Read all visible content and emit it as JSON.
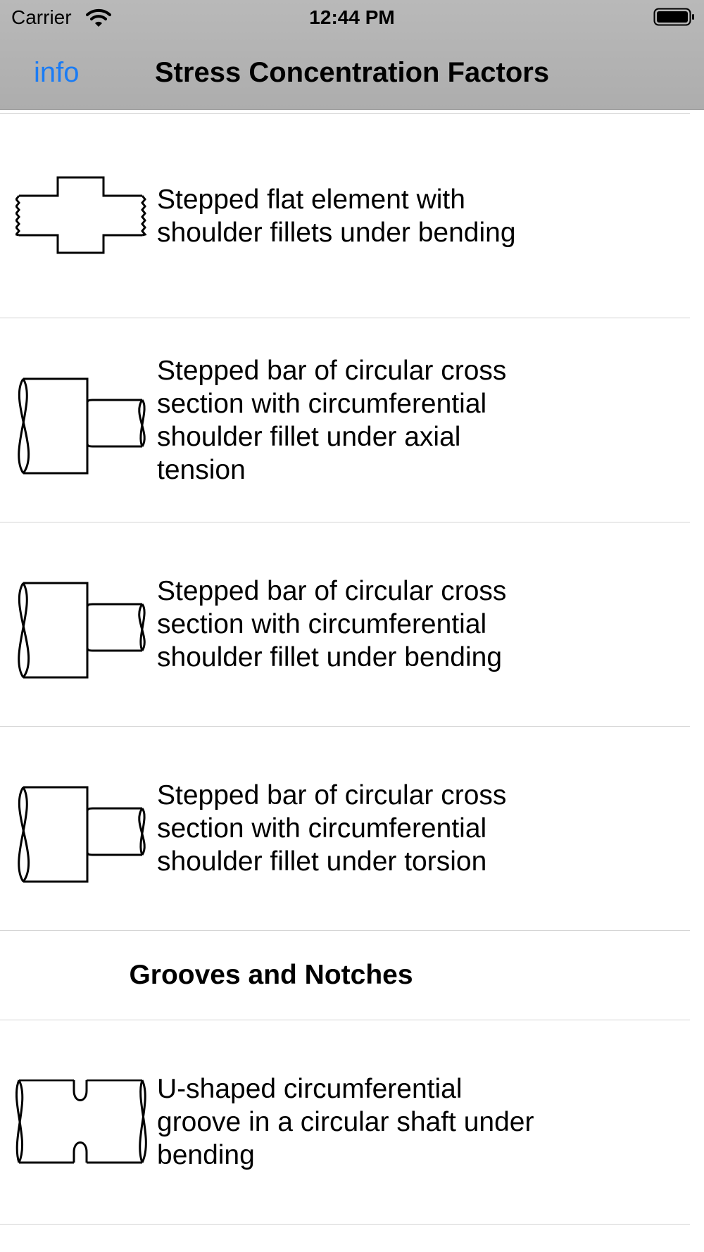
{
  "status_bar": {
    "carrier": "Carrier",
    "time": "12:44 PM",
    "wifi_icon": "wifi-icon",
    "battery_icon": "battery-full-icon"
  },
  "nav": {
    "info_label": "info",
    "title": "Stress Concentration Factors",
    "accent_color": "#1a7cf5"
  },
  "list": {
    "rows": [
      {
        "label": "Stepped flat element with shoulder fillets under bending",
        "icon": "stepped-flat-element-icon"
      },
      {
        "label": "Stepped bar of circular cross section with circumferential shoulder fillet under axial tension",
        "icon": "stepped-round-bar-icon"
      },
      {
        "label": "Stepped bar of circular cross section with circumferential shoulder fillet under bending",
        "icon": "stepped-round-bar-icon"
      },
      {
        "label": "Stepped bar of circular cross section with circumferential shoulder fillet under torsion",
        "icon": "stepped-round-bar-icon"
      }
    ],
    "section_header": "Grooves and Notches",
    "section_rows": [
      {
        "label": "U-shaped circumferential groove in a circular shaft under bending",
        "icon": "grooved-shaft-icon"
      }
    ]
  }
}
